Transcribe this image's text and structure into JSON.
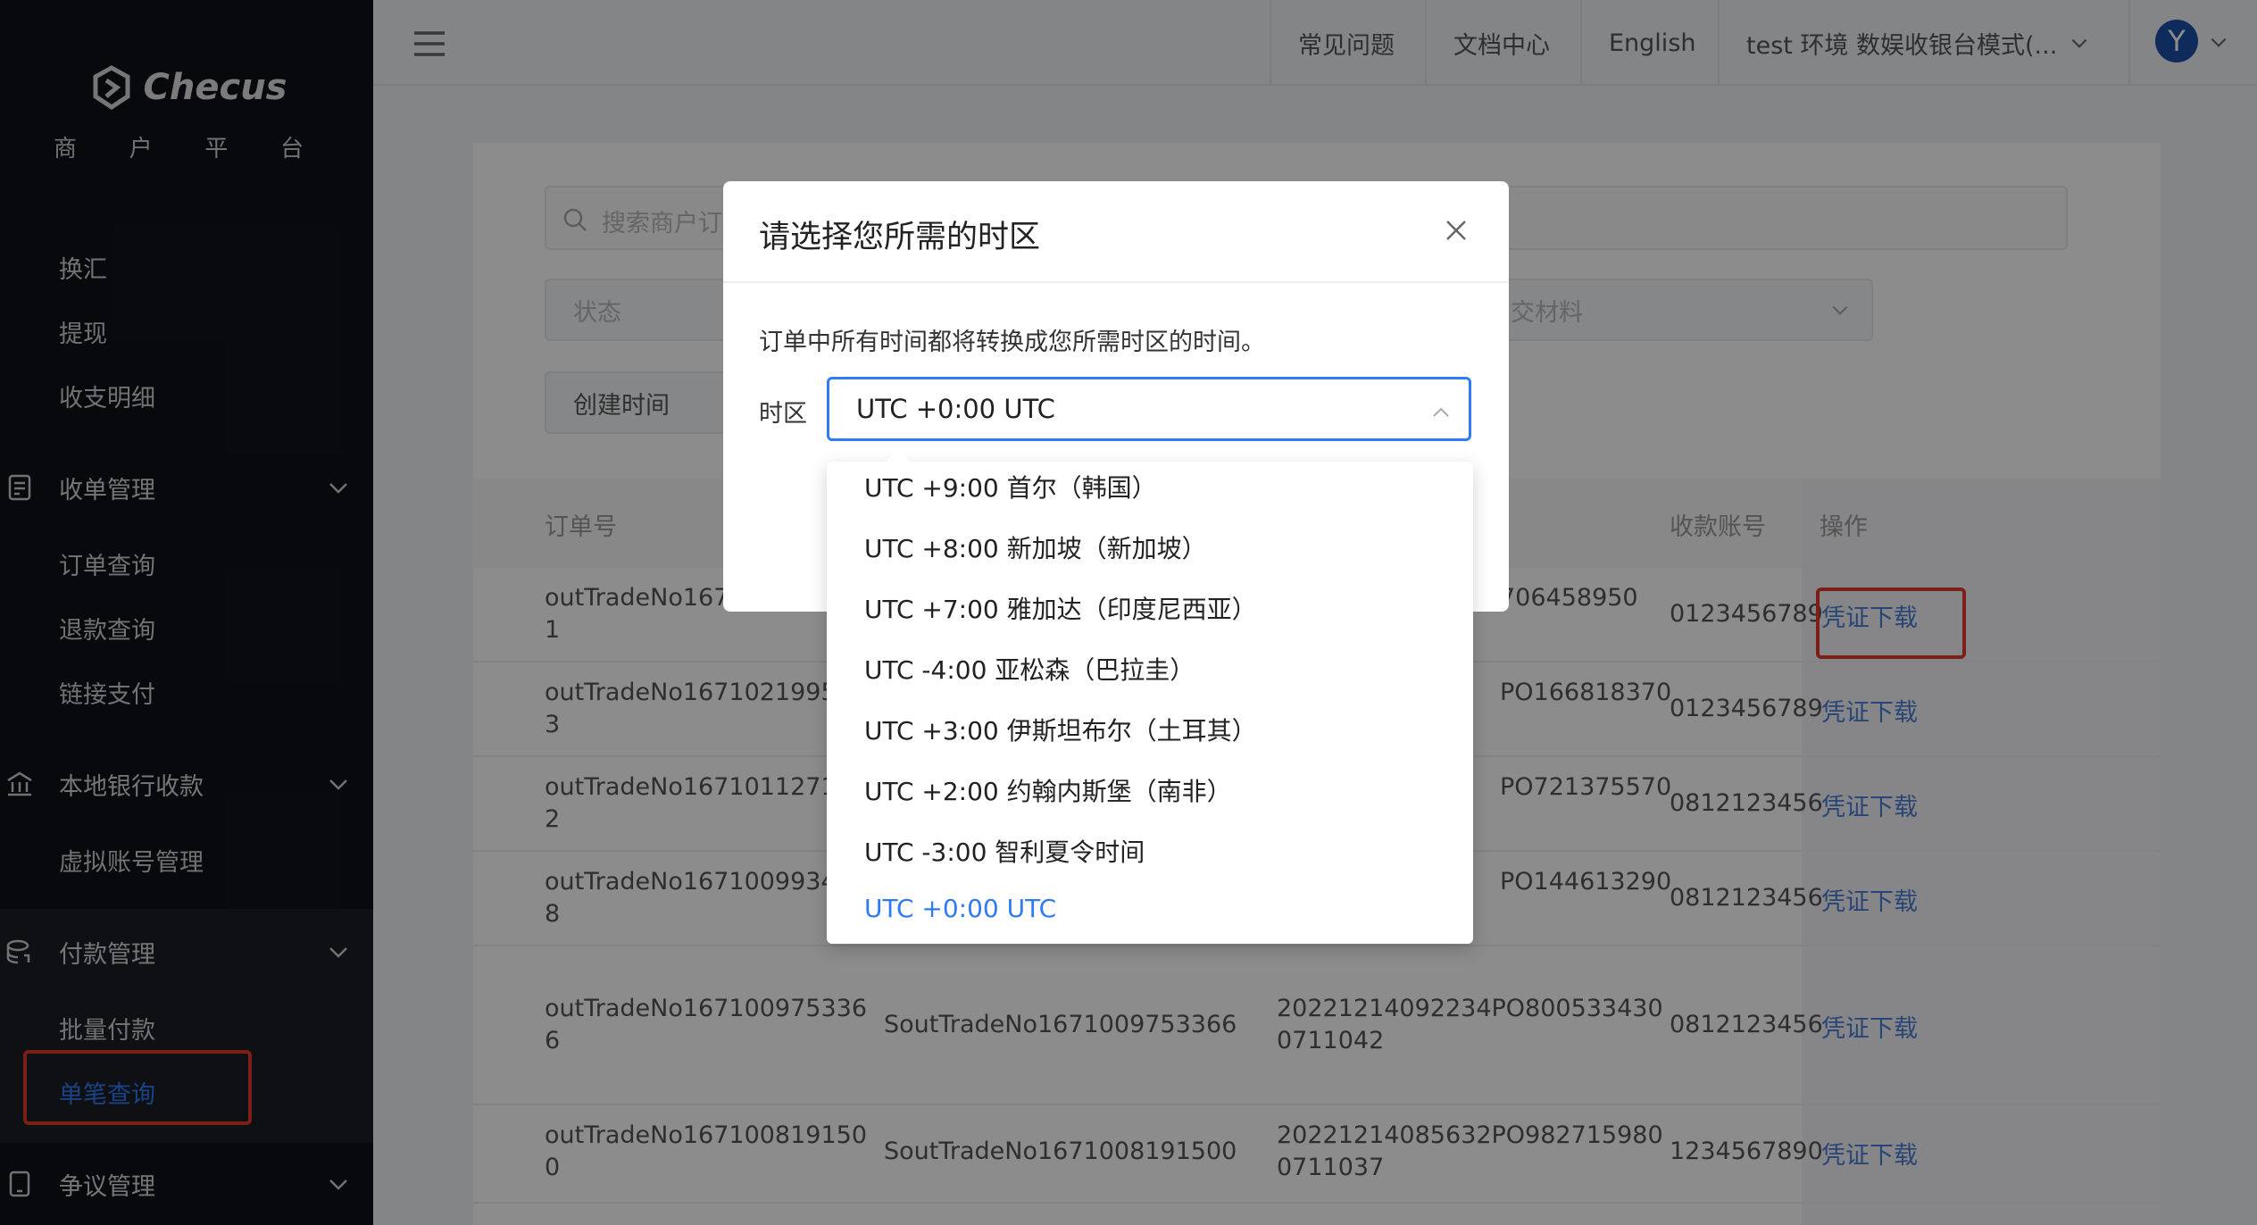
{
  "brand": {
    "name": "Checus",
    "subtitle_chars": [
      "商",
      "户",
      "平",
      "台"
    ]
  },
  "sidebar": {
    "top_items": [
      "换汇",
      "提现",
      "收支明细"
    ],
    "groups": [
      {
        "label": "收单管理",
        "items": [
          "订单查询",
          "退款查询",
          "链接支付"
        ]
      },
      {
        "label": "本地银行收款",
        "items": [
          "虚拟账号管理"
        ]
      },
      {
        "label": "付款管理",
        "items": [
          "批量付款",
          "单笔查询"
        ]
      },
      {
        "label": "争议管理",
        "items": []
      }
    ]
  },
  "header": {
    "faq": "常见问题",
    "docs": "文档中心",
    "language": "English",
    "env": "test 环境 数娱收银台模式(...",
    "avatar_letter": "Y"
  },
  "filters": {
    "search_placeholder": "搜索商户订",
    "status_placeholder": "状态",
    "materials_placeholder": "交材料",
    "created_time": "创建时间"
  },
  "table": {
    "headers": {
      "order_no": "订单号",
      "account": "收款账号",
      "action": "操作"
    },
    "rows": [
      {
        "order_a": "outTradeNo1671",
        "order_b": "1",
        "po": "706458950",
        "account": "0123456789",
        "action": "凭证下载"
      },
      {
        "order_a": "outTradeNo16710219954",
        "order_b": "3",
        "po": "PO166818370",
        "account": "0123456789",
        "action": "凭证下载"
      },
      {
        "order_a": "outTradeNo16710112717",
        "order_b": "2",
        "po": "PO721375570",
        "account": "0812123456",
        "action": "凭证下载"
      },
      {
        "order_a": "outTradeNo16710099344",
        "order_b": "8",
        "po": "PO144613290",
        "account": "0812123456",
        "action": "凭证下载"
      },
      {
        "order_a": "outTradeNo167100975336",
        "order_b": "6",
        "sout": "SoutTradeNo1671009753366",
        "po_a": "20221214092234PO800533430",
        "po_b": "0711042",
        "account": "0812123456",
        "action": "凭证下载"
      },
      {
        "order_a": "outTradeNo167100819150",
        "order_b": "0",
        "sout": "SoutTradeNo1671008191500",
        "po_a": "20221214085632PO982715980",
        "po_b": "0711037",
        "account": "1234567890",
        "action": "凭证下载"
      }
    ]
  },
  "modal": {
    "title": "请选择您所需的时区",
    "description": "订单中所有时间都将转换成您所需时区的时间。",
    "field_label": "时区",
    "selected": "UTC +0:00 UTC",
    "options": [
      "UTC +9:00 首尔（韩国）",
      "UTC +8:00 新加坡（新加坡）",
      "UTC +7:00 雅加达（印度尼西亚）",
      "UTC -4:00 亚松森（巴拉圭）",
      "UTC +3:00 伊斯坦布尔（土耳其）",
      "UTC +2:00 约翰内斯堡（南非）",
      "UTC -3:00 智利夏令时间",
      "UTC +0:00 UTC"
    ]
  },
  "colors": {
    "accent": "#2f7bf5",
    "highlight_box": "#e03a2f",
    "sidebar_bg": "#0f1217"
  }
}
